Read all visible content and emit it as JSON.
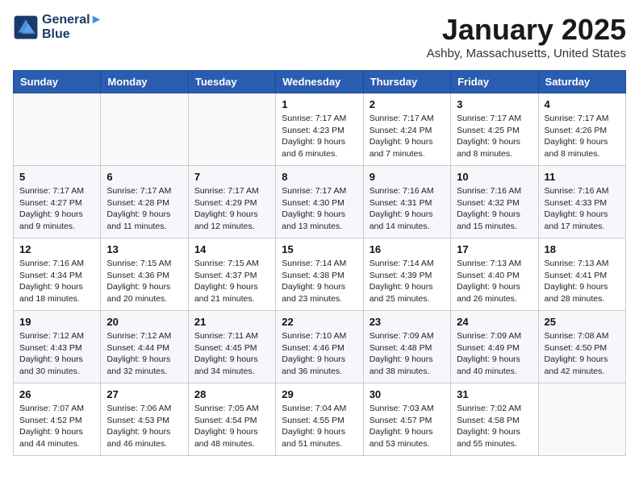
{
  "logo": {
    "line1": "General",
    "line2": "Blue"
  },
  "title": "January 2025",
  "location": "Ashby, Massachusetts, United States",
  "weekdays": [
    "Sunday",
    "Monday",
    "Tuesday",
    "Wednesday",
    "Thursday",
    "Friday",
    "Saturday"
  ],
  "weeks": [
    [
      {
        "day": "",
        "info": ""
      },
      {
        "day": "",
        "info": ""
      },
      {
        "day": "",
        "info": ""
      },
      {
        "day": "1",
        "info": "Sunrise: 7:17 AM\nSunset: 4:23 PM\nDaylight: 9 hours\nand 6 minutes."
      },
      {
        "day": "2",
        "info": "Sunrise: 7:17 AM\nSunset: 4:24 PM\nDaylight: 9 hours\nand 7 minutes."
      },
      {
        "day": "3",
        "info": "Sunrise: 7:17 AM\nSunset: 4:25 PM\nDaylight: 9 hours\nand 8 minutes."
      },
      {
        "day": "4",
        "info": "Sunrise: 7:17 AM\nSunset: 4:26 PM\nDaylight: 9 hours\nand 8 minutes."
      }
    ],
    [
      {
        "day": "5",
        "info": "Sunrise: 7:17 AM\nSunset: 4:27 PM\nDaylight: 9 hours\nand 9 minutes."
      },
      {
        "day": "6",
        "info": "Sunrise: 7:17 AM\nSunset: 4:28 PM\nDaylight: 9 hours\nand 11 minutes."
      },
      {
        "day": "7",
        "info": "Sunrise: 7:17 AM\nSunset: 4:29 PM\nDaylight: 9 hours\nand 12 minutes."
      },
      {
        "day": "8",
        "info": "Sunrise: 7:17 AM\nSunset: 4:30 PM\nDaylight: 9 hours\nand 13 minutes."
      },
      {
        "day": "9",
        "info": "Sunrise: 7:16 AM\nSunset: 4:31 PM\nDaylight: 9 hours\nand 14 minutes."
      },
      {
        "day": "10",
        "info": "Sunrise: 7:16 AM\nSunset: 4:32 PM\nDaylight: 9 hours\nand 15 minutes."
      },
      {
        "day": "11",
        "info": "Sunrise: 7:16 AM\nSunset: 4:33 PM\nDaylight: 9 hours\nand 17 minutes."
      }
    ],
    [
      {
        "day": "12",
        "info": "Sunrise: 7:16 AM\nSunset: 4:34 PM\nDaylight: 9 hours\nand 18 minutes."
      },
      {
        "day": "13",
        "info": "Sunrise: 7:15 AM\nSunset: 4:36 PM\nDaylight: 9 hours\nand 20 minutes."
      },
      {
        "day": "14",
        "info": "Sunrise: 7:15 AM\nSunset: 4:37 PM\nDaylight: 9 hours\nand 21 minutes."
      },
      {
        "day": "15",
        "info": "Sunrise: 7:14 AM\nSunset: 4:38 PM\nDaylight: 9 hours\nand 23 minutes."
      },
      {
        "day": "16",
        "info": "Sunrise: 7:14 AM\nSunset: 4:39 PM\nDaylight: 9 hours\nand 25 minutes."
      },
      {
        "day": "17",
        "info": "Sunrise: 7:13 AM\nSunset: 4:40 PM\nDaylight: 9 hours\nand 26 minutes."
      },
      {
        "day": "18",
        "info": "Sunrise: 7:13 AM\nSunset: 4:41 PM\nDaylight: 9 hours\nand 28 minutes."
      }
    ],
    [
      {
        "day": "19",
        "info": "Sunrise: 7:12 AM\nSunset: 4:43 PM\nDaylight: 9 hours\nand 30 minutes."
      },
      {
        "day": "20",
        "info": "Sunrise: 7:12 AM\nSunset: 4:44 PM\nDaylight: 9 hours\nand 32 minutes."
      },
      {
        "day": "21",
        "info": "Sunrise: 7:11 AM\nSunset: 4:45 PM\nDaylight: 9 hours\nand 34 minutes."
      },
      {
        "day": "22",
        "info": "Sunrise: 7:10 AM\nSunset: 4:46 PM\nDaylight: 9 hours\nand 36 minutes."
      },
      {
        "day": "23",
        "info": "Sunrise: 7:09 AM\nSunset: 4:48 PM\nDaylight: 9 hours\nand 38 minutes."
      },
      {
        "day": "24",
        "info": "Sunrise: 7:09 AM\nSunset: 4:49 PM\nDaylight: 9 hours\nand 40 minutes."
      },
      {
        "day": "25",
        "info": "Sunrise: 7:08 AM\nSunset: 4:50 PM\nDaylight: 9 hours\nand 42 minutes."
      }
    ],
    [
      {
        "day": "26",
        "info": "Sunrise: 7:07 AM\nSunset: 4:52 PM\nDaylight: 9 hours\nand 44 minutes."
      },
      {
        "day": "27",
        "info": "Sunrise: 7:06 AM\nSunset: 4:53 PM\nDaylight: 9 hours\nand 46 minutes."
      },
      {
        "day": "28",
        "info": "Sunrise: 7:05 AM\nSunset: 4:54 PM\nDaylight: 9 hours\nand 48 minutes."
      },
      {
        "day": "29",
        "info": "Sunrise: 7:04 AM\nSunset: 4:55 PM\nDaylight: 9 hours\nand 51 minutes."
      },
      {
        "day": "30",
        "info": "Sunrise: 7:03 AM\nSunset: 4:57 PM\nDaylight: 9 hours\nand 53 minutes."
      },
      {
        "day": "31",
        "info": "Sunrise: 7:02 AM\nSunset: 4:58 PM\nDaylight: 9 hours\nand 55 minutes."
      },
      {
        "day": "",
        "info": ""
      }
    ]
  ]
}
